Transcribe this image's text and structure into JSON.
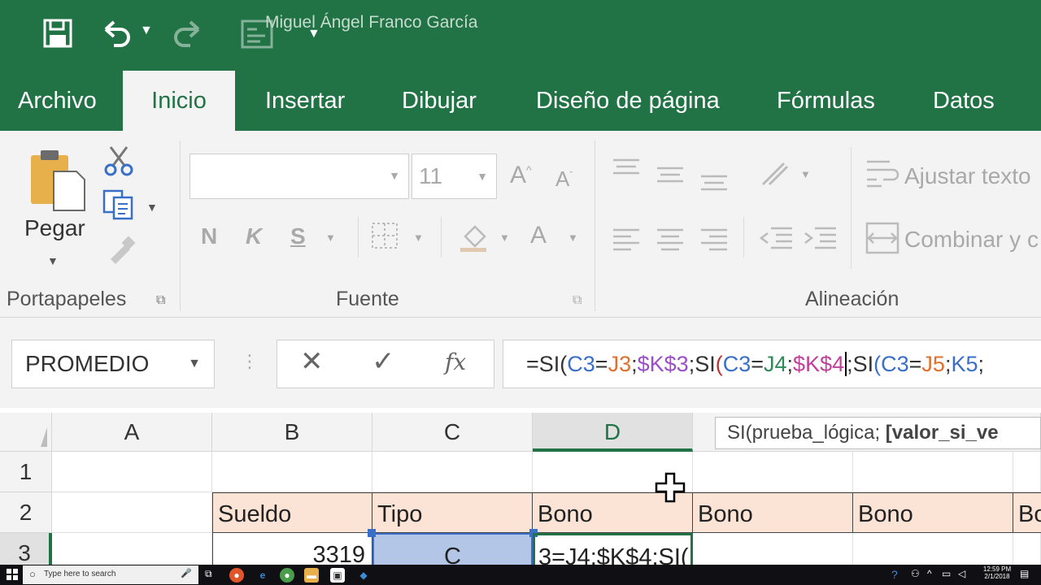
{
  "window": {
    "user_name": "Miguel Ángel Franco García"
  },
  "quick_access": {
    "save_icon": "save-icon",
    "undo_icon": "undo-icon",
    "redo_icon": "redo-icon"
  },
  "tabs": [
    {
      "label": "Archivo"
    },
    {
      "label": "Inicio"
    },
    {
      "label": "Insertar"
    },
    {
      "label": "Dibujar"
    },
    {
      "label": "Diseño de página"
    },
    {
      "label": "Fórmulas"
    },
    {
      "label": "Datos"
    }
  ],
  "ribbon": {
    "clipboard": {
      "paste_label": "Pegar",
      "group_label": "Portapapeles"
    },
    "font": {
      "font_name": "",
      "font_size": "11",
      "bold": "N",
      "italic": "K",
      "underline": "S",
      "grow": "A",
      "shrink": "A",
      "font_color": "A",
      "group_label": "Fuente"
    },
    "alignment": {
      "wrap_text": "Ajustar texto",
      "merge_center": "Combinar y c",
      "group_label": "Alineación"
    }
  },
  "formula_bar": {
    "name_box": "PROMEDIO",
    "cancel_glyph": "✕",
    "enter_glyph": "✓",
    "fx_label": "fx",
    "formula_segments": [
      {
        "text": "=SI(",
        "color": "#333333"
      },
      {
        "text": "C3",
        "color": "#3a6fc9"
      },
      {
        "text": "=",
        "color": "#333333"
      },
      {
        "text": "J3",
        "color": "#e07030"
      },
      {
        "text": ";",
        "color": "#333333"
      },
      {
        "text": "$K$3",
        "color": "#9a4fc9"
      },
      {
        "text": ";SI",
        "color": "#333333"
      },
      {
        "text": "(",
        "color": "#c03030"
      },
      {
        "text": "C3",
        "color": "#3a6fc9"
      },
      {
        "text": "=",
        "color": "#333333"
      },
      {
        "text": "J4",
        "color": "#2e8b57"
      },
      {
        "text": ";",
        "color": "#333333"
      },
      {
        "text": "$K$4",
        "color": "#c0409a"
      },
      {
        "text": ";SI",
        "color": "#333333"
      },
      {
        "text": "(",
        "color": "#3a6fc9"
      },
      {
        "text": "C3",
        "color": "#3a6fc9"
      },
      {
        "text": "=",
        "color": "#333333"
      },
      {
        "text": "J5",
        "color": "#e07030"
      },
      {
        "text": ";",
        "color": "#333333"
      },
      {
        "text": "K5",
        "color": "#3a6fc9"
      },
      {
        "text": ";",
        "color": "#333333"
      }
    ]
  },
  "tooltip": {
    "prefix": "SI(prueba_lógica; ",
    "bold_part": "[valor_si_ve"
  },
  "grid": {
    "columns": [
      "A",
      "B",
      "C",
      "D"
    ],
    "rows": [
      "1",
      "2",
      "3"
    ],
    "row2_headers": [
      "Sueldo",
      "Tipo",
      "Bono",
      "Bono",
      "Bono",
      "Bo"
    ],
    "row3": {
      "b3": "3319",
      "c3": "C",
      "d3": "3=J4;$K$4;SI("
    }
  },
  "taskbar": {
    "search_placeholder": "Type here to search",
    "time": "12:59 PM",
    "date": "2/1/2018"
  },
  "colors": {
    "excel_green": "#217346",
    "header_fill": "#fbe3d5",
    "selection_fill": "#b4c6e7"
  }
}
